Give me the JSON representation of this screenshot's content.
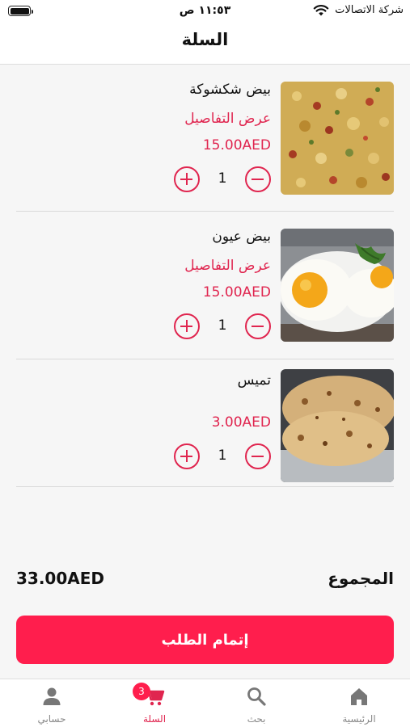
{
  "status_bar": {
    "time": "١١:٥٣ ص",
    "carrier": "شركة الاتصالات"
  },
  "header": {
    "title": "السلة"
  },
  "cart": {
    "items": [
      {
        "name": "بيض شكشوكة",
        "details_label": "عرض التفاصيل",
        "price": "15.00AED",
        "quantity": "1",
        "image": "shakshuka-eggs"
      },
      {
        "name": "بيض عيون",
        "details_label": "عرض التفاصيل",
        "price": "15.00AED",
        "quantity": "1",
        "image": "fried-eggs"
      },
      {
        "name": "تميس",
        "price": "3.00AED",
        "quantity": "1",
        "image": "tamees-bread"
      }
    ]
  },
  "total": {
    "label": "المجموع",
    "value": "33.00AED"
  },
  "checkout": {
    "label": "إتمام الطلب"
  },
  "tab_bar": {
    "tabs": [
      {
        "label": "الرئيسية",
        "icon": "home-icon",
        "active": false
      },
      {
        "label": "بحث",
        "icon": "search-icon",
        "active": false
      },
      {
        "label": "السلة",
        "icon": "cart-icon",
        "active": true,
        "badge": "3"
      },
      {
        "label": "حسابي",
        "icon": "person-icon",
        "active": false
      }
    ]
  },
  "colors": {
    "accent": "#e0254f",
    "button": "#ff1e4d",
    "background": "#f6f6f6"
  }
}
